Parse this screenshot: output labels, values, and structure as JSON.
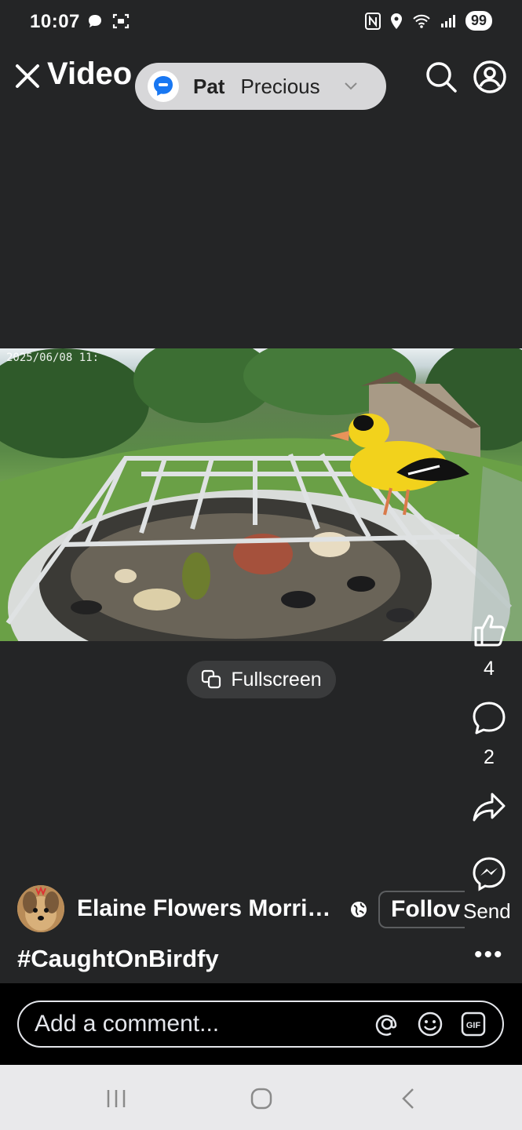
{
  "status_bar": {
    "time": "10:07",
    "battery": "99"
  },
  "header": {
    "title": "Video",
    "chat_head": {
      "first_name": "Pat",
      "second_name": "Precious"
    }
  },
  "video": {
    "timestamp": "2025/06/08 11:",
    "fullscreen_label": "Fullscreen"
  },
  "actions": {
    "like_count": "4",
    "comment_count": "2",
    "send_label": "Send"
  },
  "post": {
    "author": "Elaine Flowers Morri…",
    "follow_label": "Follov",
    "caption": "#CaughtOnBirdfy"
  },
  "comment": {
    "placeholder": "Add a comment..."
  },
  "colors": {
    "background": "#242526",
    "chat_pill": "#d7d7d9",
    "messenger_blue": "#1877f2",
    "goldfinch_yellow": "#f2d21c"
  },
  "icons": [
    "close-icon",
    "search-icon",
    "profile-icon",
    "messenger-icon",
    "chevron-down-icon",
    "fullscreen-icon",
    "like-icon",
    "comment-icon",
    "share-icon",
    "messenger-send-icon",
    "globe-icon",
    "more-icon",
    "mention-icon",
    "emoji-icon",
    "gif-icon",
    "recent-apps-icon",
    "home-icon",
    "back-icon"
  ]
}
